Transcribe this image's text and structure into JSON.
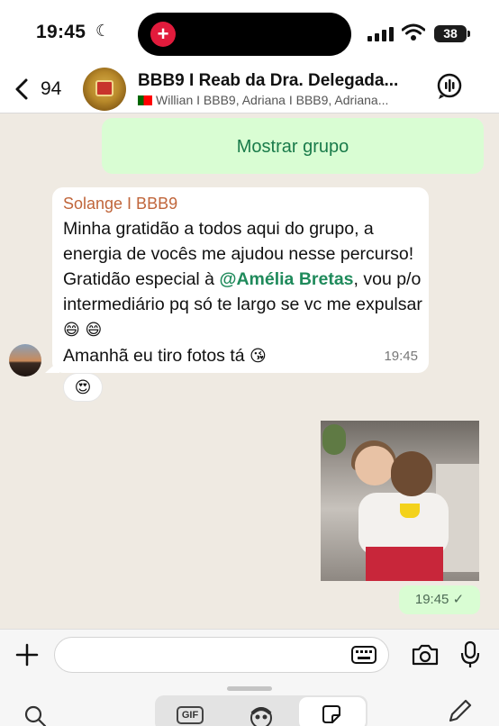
{
  "status_bar": {
    "time": "19:45",
    "battery": "38"
  },
  "header": {
    "back_count": "94",
    "title": "BBB9 I Reab da Dra. Delegada...",
    "members": "Willian I BBB9, Adriana I BBB9, Adriana..."
  },
  "chat": {
    "show_group_label": "Mostrar grupo",
    "incoming": {
      "sender": "Solange I BBB9",
      "text_before_mention": "Minha gratidão a todos aqui do grupo, a energia de vocês me ajudou nesse percurso! Gratidão especial à ",
      "mention": "@Amélia Bretas",
      "text_after_mention": ", vou p/o intermediário pq só te largo se vc me expulsar ",
      "emoji_1": "😄 😄",
      "line_last": "Amanhã eu tiro fotos tá ",
      "emoji_2": "😘",
      "time": "19:45",
      "reaction": "😍"
    },
    "outgoing": {
      "time": "19:45 ✓"
    }
  },
  "input": {
    "placeholder": ""
  },
  "tray": {
    "gif_label": "GIF"
  },
  "colors": {
    "chat_background": "#efeae2",
    "outgoing_bubble": "#d9fdd3",
    "sender_name": "#c0653a",
    "mention": "#1f8a5b"
  }
}
